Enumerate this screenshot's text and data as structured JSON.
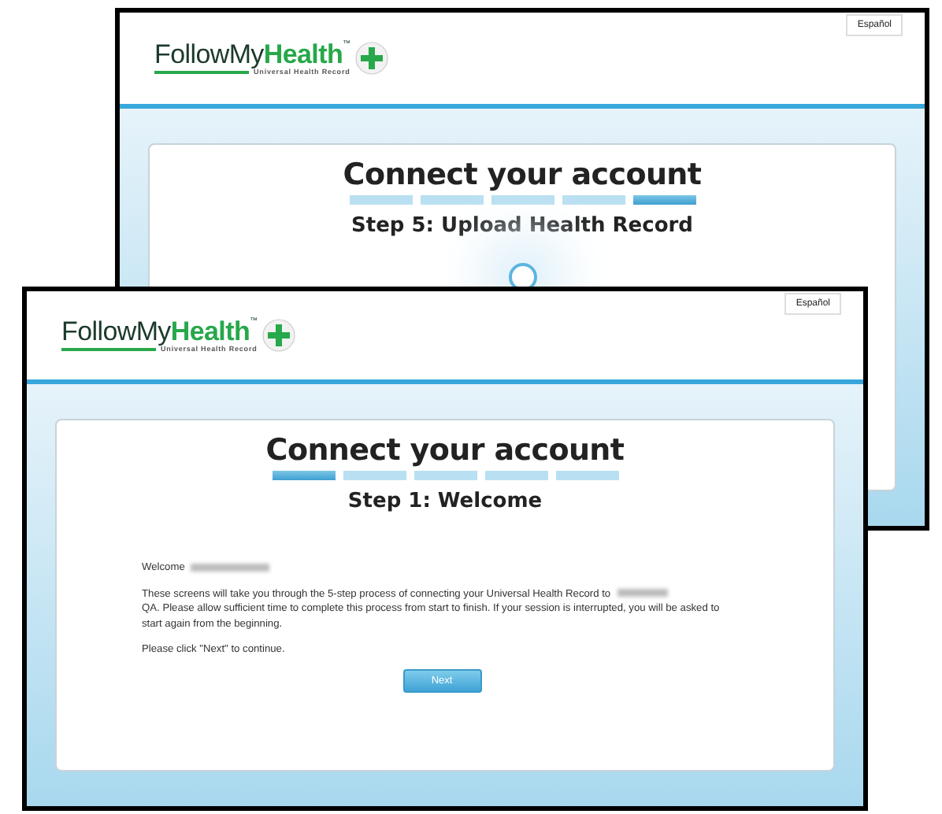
{
  "windows": [
    {
      "kind": "back",
      "language_link": "Español",
      "logo": {
        "brand_main": "FollowMy",
        "brand_accent": "Health",
        "trademark": "™",
        "tagline": "Universal Health Record"
      },
      "title": "Connect your account",
      "steps": [
        {
          "selected": false
        },
        {
          "selected": false
        },
        {
          "selected": false
        },
        {
          "selected": false
        },
        {
          "selected": true
        }
      ],
      "step_title": "Step 5: Upload Health Record"
    },
    {
      "kind": "front",
      "language_link": "Español",
      "logo": {
        "brand_main": "FollowMy",
        "brand_accent": "Health",
        "trademark": "™",
        "tagline": "Universal Health Record"
      },
      "title": "Connect your account",
      "steps": [
        {
          "selected": true
        },
        {
          "selected": false
        },
        {
          "selected": false
        },
        {
          "selected": false
        },
        {
          "selected": false
        }
      ],
      "step_title": "Step 1: Welcome",
      "content": {
        "greeting": "Welcome",
        "intro_start": "These screens will take you through the 5-step process of connecting your Universal Health Record to",
        "intro_end": "QA. Please allow sufficient time to complete this process from start to finish. If your session is interrupted, you will be asked to start again from the beginning.",
        "instruction": "Please click \"Next\" to continue.",
        "button": "Next"
      }
    }
  ]
}
